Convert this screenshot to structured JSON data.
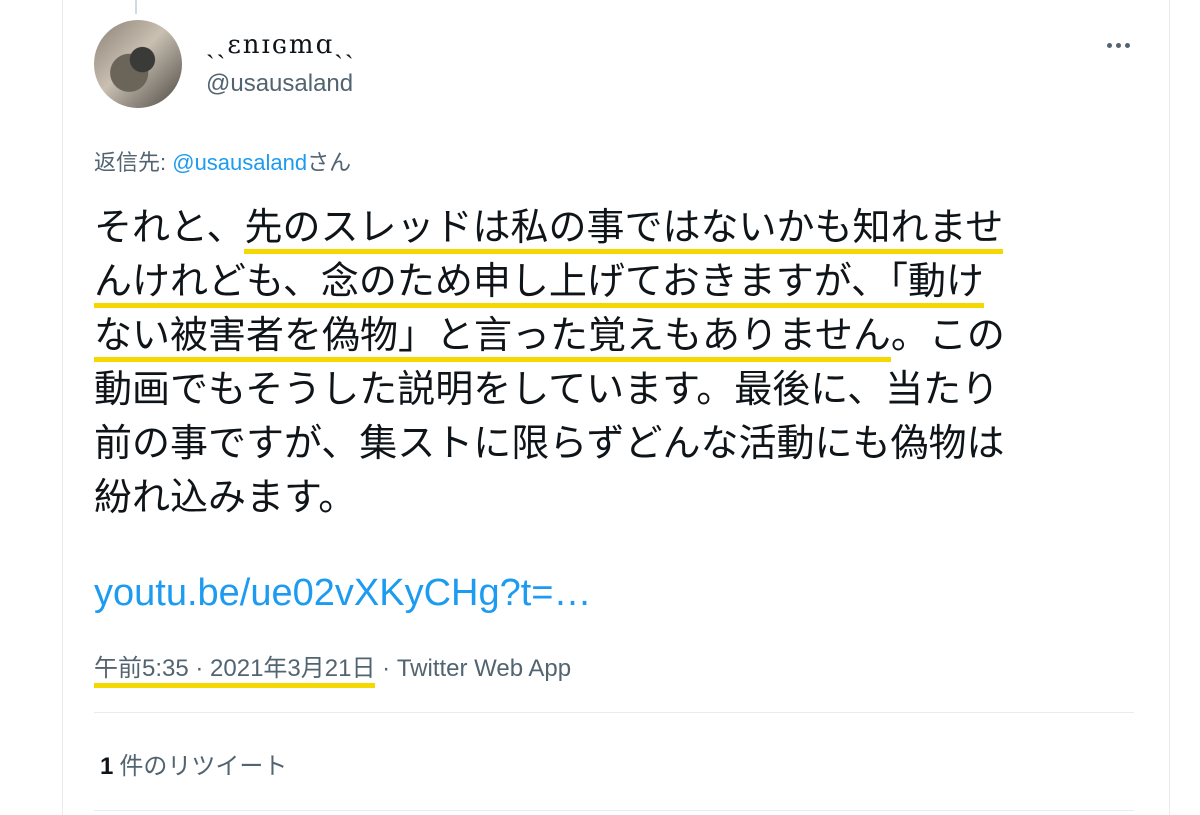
{
  "tweet": {
    "display_name": "ˏˏɛnɪɢmɑˎˎ",
    "handle": "@usausaland",
    "reply_prefix": "返信先: ",
    "reply_to": "@usausaland",
    "reply_suffix": "さん",
    "text_lines": [
      [
        "それと、",
        "先のスレッドは私の事ではないかも知れませ"
      ],
      [
        "んけれども、念のため申し上げておきますが、「動け"
      ],
      [
        "ない被害者を偽物」と言った覚えもありません",
        "。この"
      ],
      [
        "動画でもそうした説明をしています。最後に、当たり"
      ],
      [
        "前の事ですが、集ストに限らずどんな活動にも偽物は"
      ],
      [
        "紛れ込みます。"
      ]
    ],
    "link": "youtu.be/ue02vXKyCHg?t=…",
    "time": "午前5:35 · 2021年3月21日",
    "source": " · Twitter Web App",
    "retweet_count": "1",
    "retweet_label": "件のリツイート"
  },
  "icons": {
    "more": "more-horizontal-icon",
    "avatar": "user-avatar"
  },
  "colors": {
    "link": "#1d9bf0",
    "highlight": "#f5d800",
    "secondary_text": "#536471"
  }
}
